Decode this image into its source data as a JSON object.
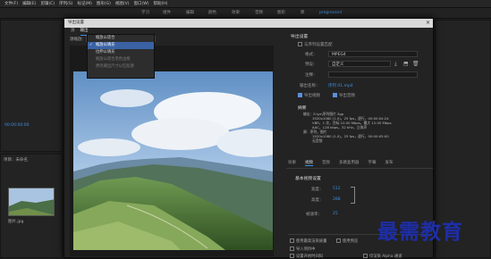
{
  "menu": [
    "文件(F)",
    "编辑(E)",
    "剪辑(C)",
    "序列(S)",
    "标记(M)",
    "图形(G)",
    "视图(V)",
    "窗口(W)",
    "帮助(H)"
  ],
  "workspace_tabs": [
    "学习",
    "组件",
    "编辑",
    "颜色",
    "效果",
    "音频",
    "图形",
    "库",
    "progressed"
  ],
  "dialog": {
    "title": "导出设置",
    "close": "×",
    "tabs": [
      "源",
      "输出"
    ],
    "source_scaling_label": "源缩放：",
    "source_scaling_value": "缩放以适合",
    "dropdown_options": [
      "缩放以适合",
      "缩放以填充",
      "拉伸以填充",
      "缩放以适合黑色边框",
      "更改输出尺寸以匹配源"
    ]
  },
  "export_settings": {
    "section_title": "导出设置",
    "match_sequence": "与序列设置匹配",
    "format_label": "格式：",
    "format_value": "MPEG4",
    "preset_label": "预设：",
    "preset_value": "自定义",
    "comments_label": "注释：",
    "output_name_label": "输出名称：",
    "output_name_value": "序列 01.mp4",
    "export_video": "导出视频",
    "export_audio": "导出音频",
    "summary_title": "摘要",
    "summary_output": "输出：E:\\pr\\序列图片.3gp",
    "summary_lines": [
      "1920x1080 (1.0)，25 fps，逐行，00:00:04:24",
      "VBR，1 次，目标 10.00 Mbps，最大 12.00 Mbps",
      "AAC，128 kbps，32 kHz，立体声"
    ],
    "summary_source": "源：序列，图片",
    "summary_source_lines": [
      "1920x1080 (1.0)，25 fps，逐行，00:00:05:00",
      "无音频"
    ]
  },
  "bottom_tabs": [
    "效果",
    "视频",
    "音频",
    "多路复用器",
    "字幕",
    "发布"
  ],
  "video_settings": {
    "title": "基本视频设置",
    "width_label": "宽度：",
    "width_value": "512",
    "height_label": "高度：",
    "height_value": "288",
    "fps_label": "帧速率：",
    "fps_value": "25"
  },
  "footer_options": [
    "使用最高渲染质量",
    "使用预览",
    "导入项目中",
    "设置开始时间码",
    "仅渲染 Alpha 通道"
  ],
  "left_panel": {
    "timecode": "00:00:00:00",
    "label": "项目：未命名",
    "item": "图片.jpg"
  },
  "watermark": "最需教育"
}
